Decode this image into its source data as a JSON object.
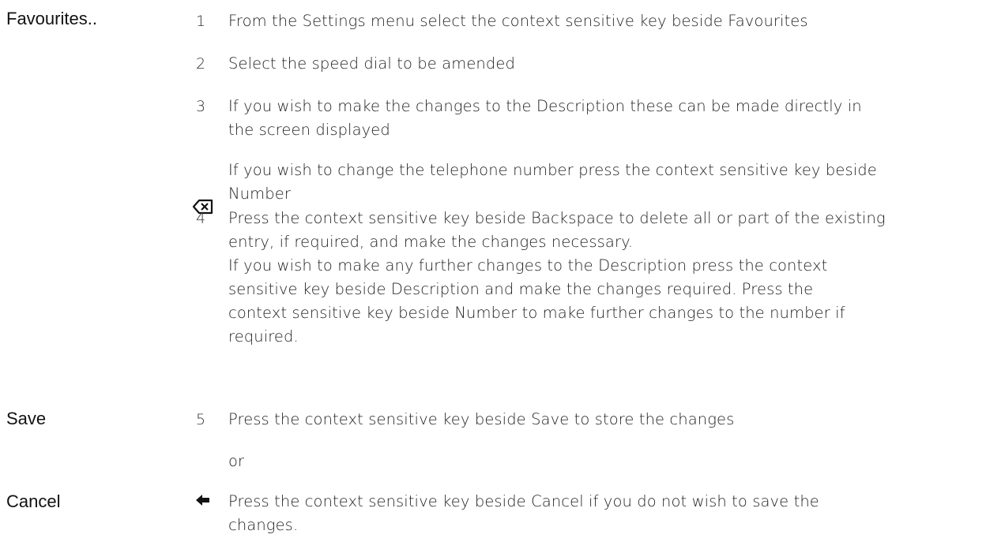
{
  "labels": {
    "favourites": "Favourites..",
    "save": "Save",
    "cancel": "Cancel"
  },
  "icons": {
    "backspace": "backspace-icon",
    "cancel": "left-arrow-icon"
  },
  "steps": [
    {
      "num": "1",
      "lines": [
        "From the Settings menu select the context sensitive key beside Favourites"
      ]
    },
    {
      "num": "2",
      "lines": [
        "Select the speed dial to be amended"
      ]
    },
    {
      "num": "3",
      "lines": [
        "If you wish to make the changes to the Description these can be made directly in",
        "the screen displayed"
      ]
    },
    {
      "num": "",
      "lines": [
        "If you wish to change the telephone number press the context sensitive key beside",
        "Number"
      ]
    },
    {
      "num": "4",
      "lines": [
        "Press the context sensitive key beside Backspace to delete all or part of the existing",
        "entry, if required, and make the changes necessary.",
        "If you wish to make any further changes to the Description press the context",
        "sensitive key beside Description and make the changes required.  Press the",
        "context sensitive key beside Number to make further changes to the number if",
        "required."
      ]
    },
    {
      "num": "5",
      "lines": [
        "Press the context sensitive key beside Save to store the changes"
      ]
    },
    {
      "num": "",
      "lines": [
        "or"
      ]
    },
    {
      "num": "",
      "lines": [
        "Press the context sensitive key beside Cancel if you do not wish to save the",
        "changes."
      ]
    }
  ]
}
